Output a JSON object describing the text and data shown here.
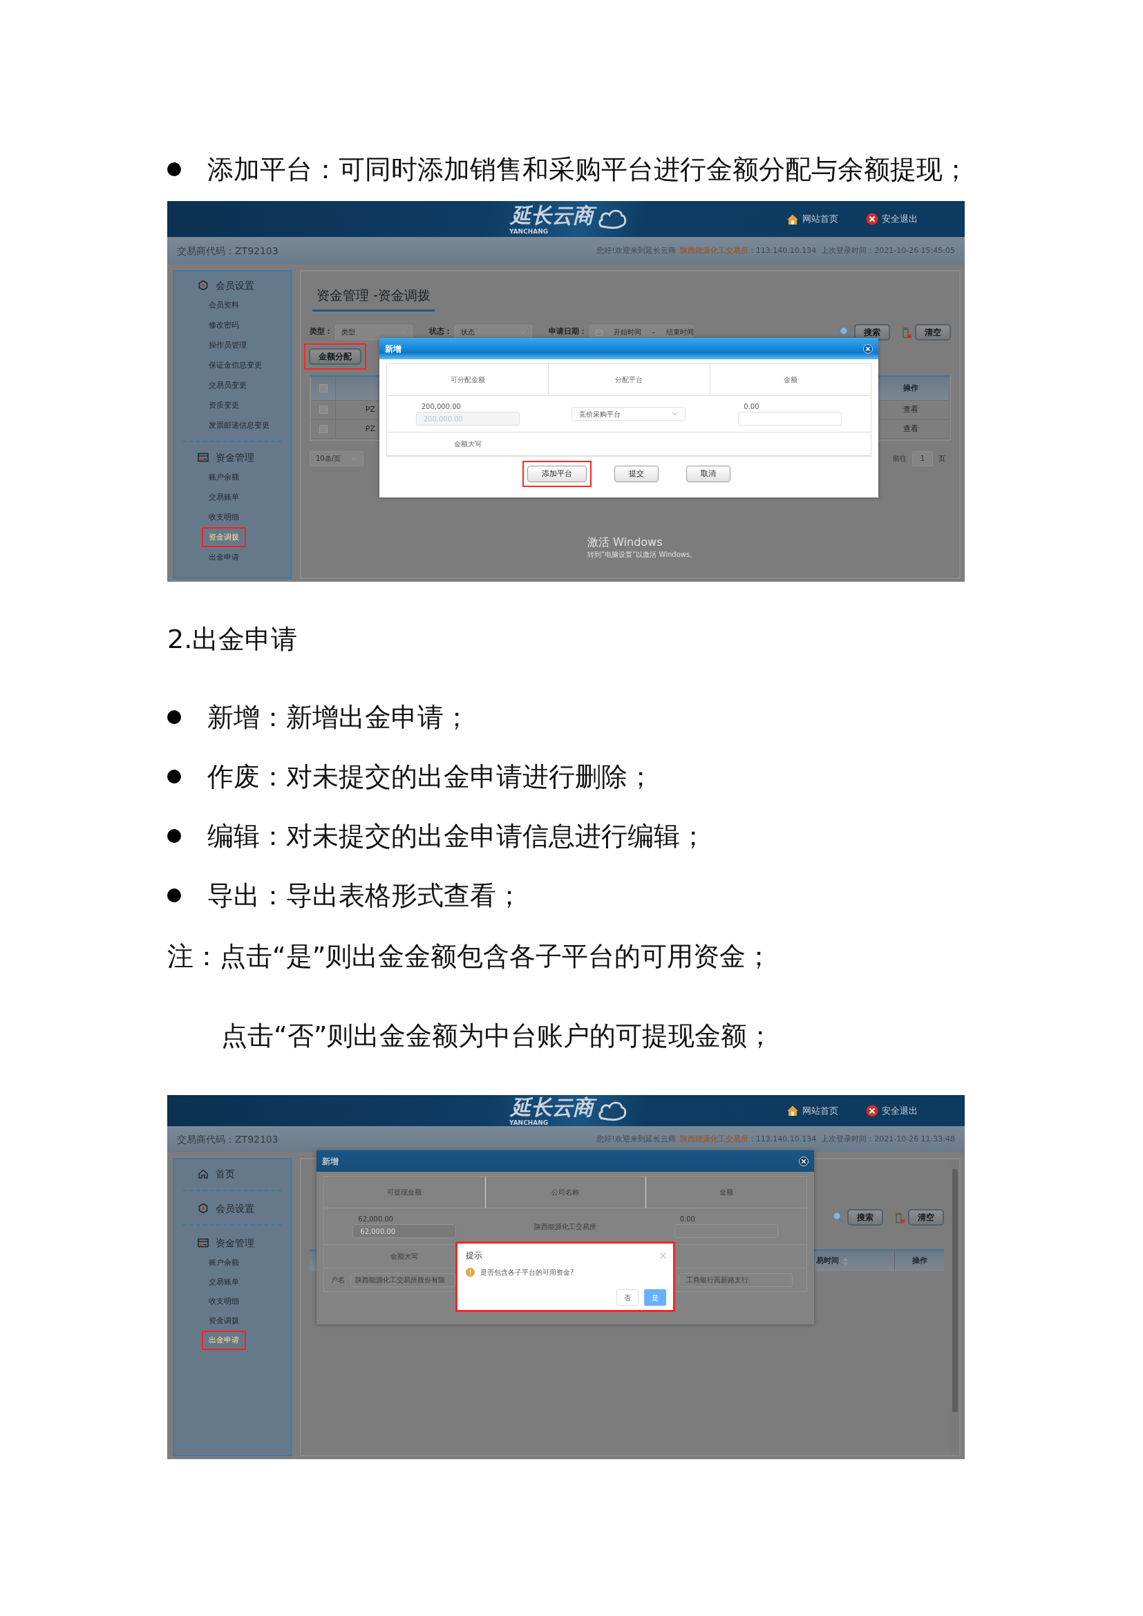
{
  "intro_bullets": [
    {
      "text": "添加平台：可同时添加销售和采购平台进行金额分配与余额提现；"
    }
  ],
  "screenshot_1": {
    "header": {
      "logo": "延长云商",
      "logo_caption": "YANCHANG",
      "links": [
        {
          "kind": "home",
          "label": "网站首页"
        },
        {
          "kind": "exit",
          "label": "安全退出"
        }
      ]
    },
    "info_bar": {
      "trader_code": "交易商代码：ZT92103",
      "welcome": "您好!欢迎来到延长云商",
      "exchange": "陕西能源化工交易所",
      "login_info": "：113.140.10.134  上次登录时间：2021-10-26 15:45:05"
    },
    "sidebar": [
      {
        "kind": "settings",
        "title": "会员设置",
        "items": [
          {
            "label": "会员资料",
            "selected": false
          },
          {
            "label": "修改密码",
            "selected": false
          },
          {
            "label": "操作员管理",
            "selected": false
          },
          {
            "label": "保证金信息变更",
            "selected": false
          },
          {
            "label": "交易员变更",
            "selected": false
          },
          {
            "label": "资质变更",
            "selected": false
          },
          {
            "label": "发票邮递信息变更",
            "selected": false
          }
        ]
      },
      {
        "kind": "funds",
        "title": "资金管理",
        "items": [
          {
            "label": "账户余额",
            "selected": false
          },
          {
            "label": "交易账单",
            "selected": false
          },
          {
            "label": "收支明细",
            "selected": false
          },
          {
            "label": "资金调拨",
            "selected": true
          },
          {
            "label": "出金申请",
            "selected": false
          }
        ]
      }
    ],
    "main": {
      "title": "资金管理 -资金调拨",
      "filters": [
        {
          "kind": "select",
          "label": "类型：",
          "placeholder": "类型"
        },
        {
          "kind": "select",
          "label": "状态：",
          "placeholder": "状态"
        },
        {
          "kind": "daterange",
          "label": "申请日期：",
          "start_placeholder": "开始时间",
          "separator": "-",
          "end_placeholder": "结束时间"
        }
      ],
      "search_button": "搜索",
      "clear_button": "清空",
      "toolbar_button": {
        "label": "金额分配",
        "highlighted": true
      },
      "table": {
        "header_checked": false,
        "columns": [
          {
            "label": "操作",
            "sortable": false
          }
        ],
        "rows": [
          {
            "checked": false,
            "code": "PZ",
            "action": "查看"
          },
          {
            "checked": false,
            "code": "PZ",
            "action": "查看"
          }
        ]
      },
      "pagination": {
        "page_size": "10条/页",
        "goto": "前往",
        "page": "1",
        "page_suffix": "页"
      }
    },
    "modal": {
      "title": "新增",
      "active": true,
      "columns": [
        "可分配金额",
        "分配平台",
        "金额"
      ],
      "rows": [
        {
          "kind": "values",
          "cells": [
            {
              "kind": "amount",
              "reading": "200,000.00",
              "value": "200,000.00",
              "disabled": true
            },
            {
              "kind": "select",
              "value": "竞价采购平台"
            },
            {
              "kind": "amount",
              "reading": "0.00",
              "disabled": false
            }
          ]
        },
        {
          "kind": "label",
          "label": "金额大写"
        }
      ],
      "buttons": [
        {
          "label": "添加平台",
          "highlighted": true
        },
        {
          "label": "提交",
          "highlighted": false
        },
        {
          "label": "取消",
          "highlighted": false
        }
      ]
    },
    "watermark": {
      "title": "激活 Windows",
      "subtitle": "转到“电脑设置”以激活 Windows。"
    }
  },
  "section_heading": "2.出金申请",
  "bullets": [
    {
      "text": "新增：新增出金申请；"
    },
    {
      "text": "作废：对未提交的出金申请进行删除；"
    },
    {
      "text": "编辑：对未提交的出金申请信息进行编辑；"
    },
    {
      "text": "导出：导出表格形式查看；"
    }
  ],
  "note": {
    "lines": [
      "注：点击“是”则出金金额包含各子平台的可用资金；",
      "点击“否”则出金金额为中台账户的可提现金额；"
    ]
  },
  "screenshot_2": {
    "header": {
      "logo": "延长云商",
      "logo_caption": "YANCHANG",
      "links": [
        {
          "kind": "home",
          "label": "网站首页"
        },
        {
          "kind": "exit",
          "label": "安全退出"
        }
      ]
    },
    "info_bar": {
      "trader_code": "交易商代码：ZT92103",
      "welcome": "您好!欢迎来到延长云商",
      "exchange": "陕西能源化工交易所",
      "login_info": "：113.140.10.134  上次登录时间：2021-10-26 11:33:48"
    },
    "sidebar": [
      {
        "kind": "home",
        "title": "首页"
      },
      {
        "kind": "settings",
        "title": "会员设置"
      },
      {
        "kind": "funds",
        "title": "资金管理",
        "items": [
          {
            "label": "账户余额",
            "selected": false
          },
          {
            "label": "交易账单",
            "selected": false
          },
          {
            "label": "收支明细",
            "selected": false
          },
          {
            "label": "资金调拨",
            "selected": false
          },
          {
            "label": "出金申请",
            "selected": true
          }
        ]
      }
    ],
    "main": {
      "search_button": "搜索",
      "clear_button": "清空",
      "table": {
        "columns": [
          {
            "label": "易时间",
            "sortable": true
          },
          {
            "label": "操作",
            "sortable": false
          }
        ]
      },
      "scrollbar": true
    },
    "modal": {
      "title": "新增",
      "active": false,
      "columns": [
        "可提现金额",
        "公司名称",
        "金额"
      ],
      "rows": [
        {
          "kind": "values",
          "cells": [
            {
              "kind": "amount",
              "reading": "62,000.00",
              "value": "62,000.00",
              "disabled": true
            },
            {
              "kind": "text",
              "value": "陕西能源化工交易所"
            },
            {
              "kind": "amount",
              "reading": "0.00",
              "disabled": false
            }
          ]
        },
        {
          "kind": "label",
          "label": "金额大写"
        },
        {
          "kind": "account",
          "label": "户名",
          "name_value": "陕西能源化工交易所股份有限",
          "bank_value": "工商银行高新路支行"
        }
      ]
    },
    "dialog": {
      "title": "提示",
      "message": "是否包含各子平台的可用资金?",
      "highlighted": true,
      "buttons": [
        {
          "label": "否",
          "primary": false
        },
        {
          "label": "是",
          "primary": true
        }
      ]
    }
  }
}
